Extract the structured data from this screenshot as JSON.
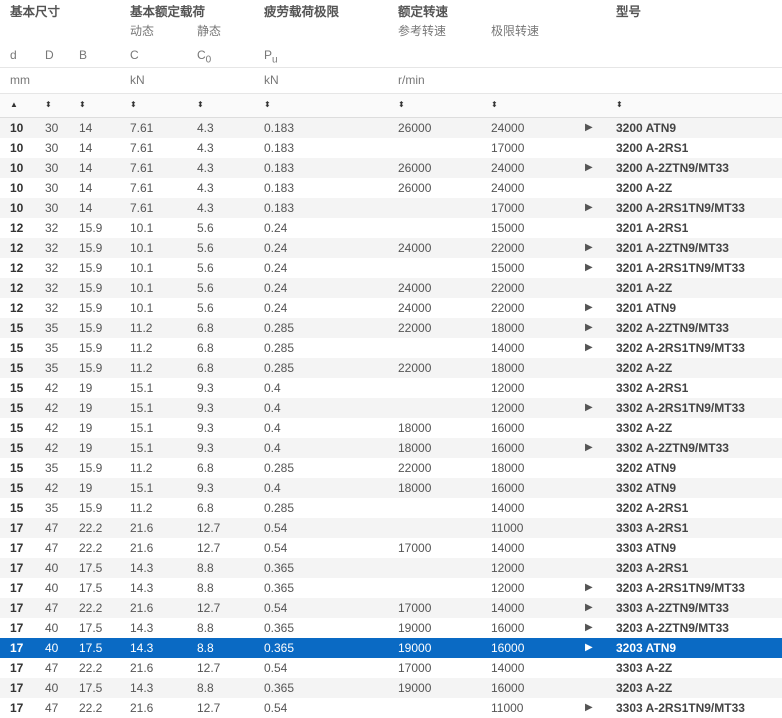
{
  "header": {
    "group_basic_dims": "基本尺寸",
    "group_load_ratings": "基本额定载荷",
    "group_fatigue": "疲劳载荷极限",
    "group_speed": "额定转速",
    "group_designation": "型号",
    "sub_dynamic": "动态",
    "sub_static": "静态",
    "sub_reference_speed": "参考转速",
    "sub_limiting_speed": "极限转速",
    "sym_d": "d",
    "sym_D": "D",
    "sym_B": "B",
    "sym_C": "C",
    "sym_C0_base": "C",
    "sym_C0_sub": "0",
    "sym_Pu_base": "P",
    "sym_Pu_sub": "u",
    "unit_mm": "mm",
    "unit_kN_1": "kN",
    "unit_kN_2": "kN",
    "unit_rpm": "r/min"
  },
  "sort_icons": {
    "active": "▲",
    "inactive": "⬍"
  },
  "rows": [
    {
      "d": "10",
      "D": "30",
      "B": "14",
      "C": "7.61",
      "C0": "4.3",
      "Pu": "0.183",
      "ref": "26000",
      "lim": "24000",
      "arrow": "▶",
      "type": "3200 ATN9"
    },
    {
      "d": "10",
      "D": "30",
      "B": "14",
      "C": "7.61",
      "C0": "4.3",
      "Pu": "0.183",
      "ref": "",
      "lim": "17000",
      "arrow": "",
      "type": "3200 A-2RS1"
    },
    {
      "d": "10",
      "D": "30",
      "B": "14",
      "C": "7.61",
      "C0": "4.3",
      "Pu": "0.183",
      "ref": "26000",
      "lim": "24000",
      "arrow": "▶",
      "type": "3200 A-2ZTN9/MT33"
    },
    {
      "d": "10",
      "D": "30",
      "B": "14",
      "C": "7.61",
      "C0": "4.3",
      "Pu": "0.183",
      "ref": "26000",
      "lim": "24000",
      "arrow": "",
      "type": "3200 A-2Z"
    },
    {
      "d": "10",
      "D": "30",
      "B": "14",
      "C": "7.61",
      "C0": "4.3",
      "Pu": "0.183",
      "ref": "",
      "lim": "17000",
      "arrow": "▶",
      "type": "3200 A-2RS1TN9/MT33"
    },
    {
      "d": "12",
      "D": "32",
      "B": "15.9",
      "C": "10.1",
      "C0": "5.6",
      "Pu": "0.24",
      "ref": "",
      "lim": "15000",
      "arrow": "",
      "type": "3201 A-2RS1"
    },
    {
      "d": "12",
      "D": "32",
      "B": "15.9",
      "C": "10.1",
      "C0": "5.6",
      "Pu": "0.24",
      "ref": "24000",
      "lim": "22000",
      "arrow": "▶",
      "type": "3201 A-2ZTN9/MT33"
    },
    {
      "d": "12",
      "D": "32",
      "B": "15.9",
      "C": "10.1",
      "C0": "5.6",
      "Pu": "0.24",
      "ref": "",
      "lim": "15000",
      "arrow": "▶",
      "type": "3201 A-2RS1TN9/MT33"
    },
    {
      "d": "12",
      "D": "32",
      "B": "15.9",
      "C": "10.1",
      "C0": "5.6",
      "Pu": "0.24",
      "ref": "24000",
      "lim": "22000",
      "arrow": "",
      "type": "3201 A-2Z"
    },
    {
      "d": "12",
      "D": "32",
      "B": "15.9",
      "C": "10.1",
      "C0": "5.6",
      "Pu": "0.24",
      "ref": "24000",
      "lim": "22000",
      "arrow": "▶",
      "type": "3201 ATN9"
    },
    {
      "d": "15",
      "D": "35",
      "B": "15.9",
      "C": "11.2",
      "C0": "6.8",
      "Pu": "0.285",
      "ref": "22000",
      "lim": "18000",
      "arrow": "▶",
      "type": "3202 A-2ZTN9/MT33"
    },
    {
      "d": "15",
      "D": "35",
      "B": "15.9",
      "C": "11.2",
      "C0": "6.8",
      "Pu": "0.285",
      "ref": "",
      "lim": "14000",
      "arrow": "▶",
      "type": "3202 A-2RS1TN9/MT33"
    },
    {
      "d": "15",
      "D": "35",
      "B": "15.9",
      "C": "11.2",
      "C0": "6.8",
      "Pu": "0.285",
      "ref": "22000",
      "lim": "18000",
      "arrow": "",
      "type": "3202 A-2Z"
    },
    {
      "d": "15",
      "D": "42",
      "B": "19",
      "C": "15.1",
      "C0": "9.3",
      "Pu": "0.4",
      "ref": "",
      "lim": "12000",
      "arrow": "",
      "type": "3302 A-2RS1"
    },
    {
      "d": "15",
      "D": "42",
      "B": "19",
      "C": "15.1",
      "C0": "9.3",
      "Pu": "0.4",
      "ref": "",
      "lim": "12000",
      "arrow": "▶",
      "type": "3302 A-2RS1TN9/MT33"
    },
    {
      "d": "15",
      "D": "42",
      "B": "19",
      "C": "15.1",
      "C0": "9.3",
      "Pu": "0.4",
      "ref": "18000",
      "lim": "16000",
      "arrow": "",
      "type": "3302 A-2Z"
    },
    {
      "d": "15",
      "D": "42",
      "B": "19",
      "C": "15.1",
      "C0": "9.3",
      "Pu": "0.4",
      "ref": "18000",
      "lim": "16000",
      "arrow": "▶",
      "type": "3302 A-2ZTN9/MT33"
    },
    {
      "d": "15",
      "D": "35",
      "B": "15.9",
      "C": "11.2",
      "C0": "6.8",
      "Pu": "0.285",
      "ref": "22000",
      "lim": "18000",
      "arrow": "",
      "type": "3202 ATN9"
    },
    {
      "d": "15",
      "D": "42",
      "B": "19",
      "C": "15.1",
      "C0": "9.3",
      "Pu": "0.4",
      "ref": "18000",
      "lim": "16000",
      "arrow": "",
      "type": "3302 ATN9"
    },
    {
      "d": "15",
      "D": "35",
      "B": "15.9",
      "C": "11.2",
      "C0": "6.8",
      "Pu": "0.285",
      "ref": "",
      "lim": "14000",
      "arrow": "",
      "type": "3202 A-2RS1"
    },
    {
      "d": "17",
      "D": "47",
      "B": "22.2",
      "C": "21.6",
      "C0": "12.7",
      "Pu": "0.54",
      "ref": "",
      "lim": "11000",
      "arrow": "",
      "type": "3303 A-2RS1"
    },
    {
      "d": "17",
      "D": "47",
      "B": "22.2",
      "C": "21.6",
      "C0": "12.7",
      "Pu": "0.54",
      "ref": "17000",
      "lim": "14000",
      "arrow": "",
      "type": "3303 ATN9"
    },
    {
      "d": "17",
      "D": "40",
      "B": "17.5",
      "C": "14.3",
      "C0": "8.8",
      "Pu": "0.365",
      "ref": "",
      "lim": "12000",
      "arrow": "",
      "type": "3203 A-2RS1"
    },
    {
      "d": "17",
      "D": "40",
      "B": "17.5",
      "C": "14.3",
      "C0": "8.8",
      "Pu": "0.365",
      "ref": "",
      "lim": "12000",
      "arrow": "▶",
      "type": "3203 A-2RS1TN9/MT33"
    },
    {
      "d": "17",
      "D": "47",
      "B": "22.2",
      "C": "21.6",
      "C0": "12.7",
      "Pu": "0.54",
      "ref": "17000",
      "lim": "14000",
      "arrow": "▶",
      "type": "3303 A-2ZTN9/MT33"
    },
    {
      "d": "17",
      "D": "40",
      "B": "17.5",
      "C": "14.3",
      "C0": "8.8",
      "Pu": "0.365",
      "ref": "19000",
      "lim": "16000",
      "arrow": "▶",
      "type": "3203 A-2ZTN9/MT33"
    },
    {
      "d": "17",
      "D": "40",
      "B": "17.5",
      "C": "14.3",
      "C0": "8.8",
      "Pu": "0.365",
      "ref": "19000",
      "lim": "16000",
      "arrow": "▶",
      "type": "3203 ATN9",
      "selected": true
    },
    {
      "d": "17",
      "D": "47",
      "B": "22.2",
      "C": "21.6",
      "C0": "12.7",
      "Pu": "0.54",
      "ref": "17000",
      "lim": "14000",
      "arrow": "",
      "type": "3303 A-2Z"
    },
    {
      "d": "17",
      "D": "40",
      "B": "17.5",
      "C": "14.3",
      "C0": "8.8",
      "Pu": "0.365",
      "ref": "19000",
      "lim": "16000",
      "arrow": "",
      "type": "3203 A-2Z"
    },
    {
      "d": "17",
      "D": "47",
      "B": "22.2",
      "C": "21.6",
      "C0": "12.7",
      "Pu": "0.54",
      "ref": "",
      "lim": "11000",
      "arrow": "▶",
      "type": "3303 A-2RS1TN9/MT33"
    }
  ]
}
